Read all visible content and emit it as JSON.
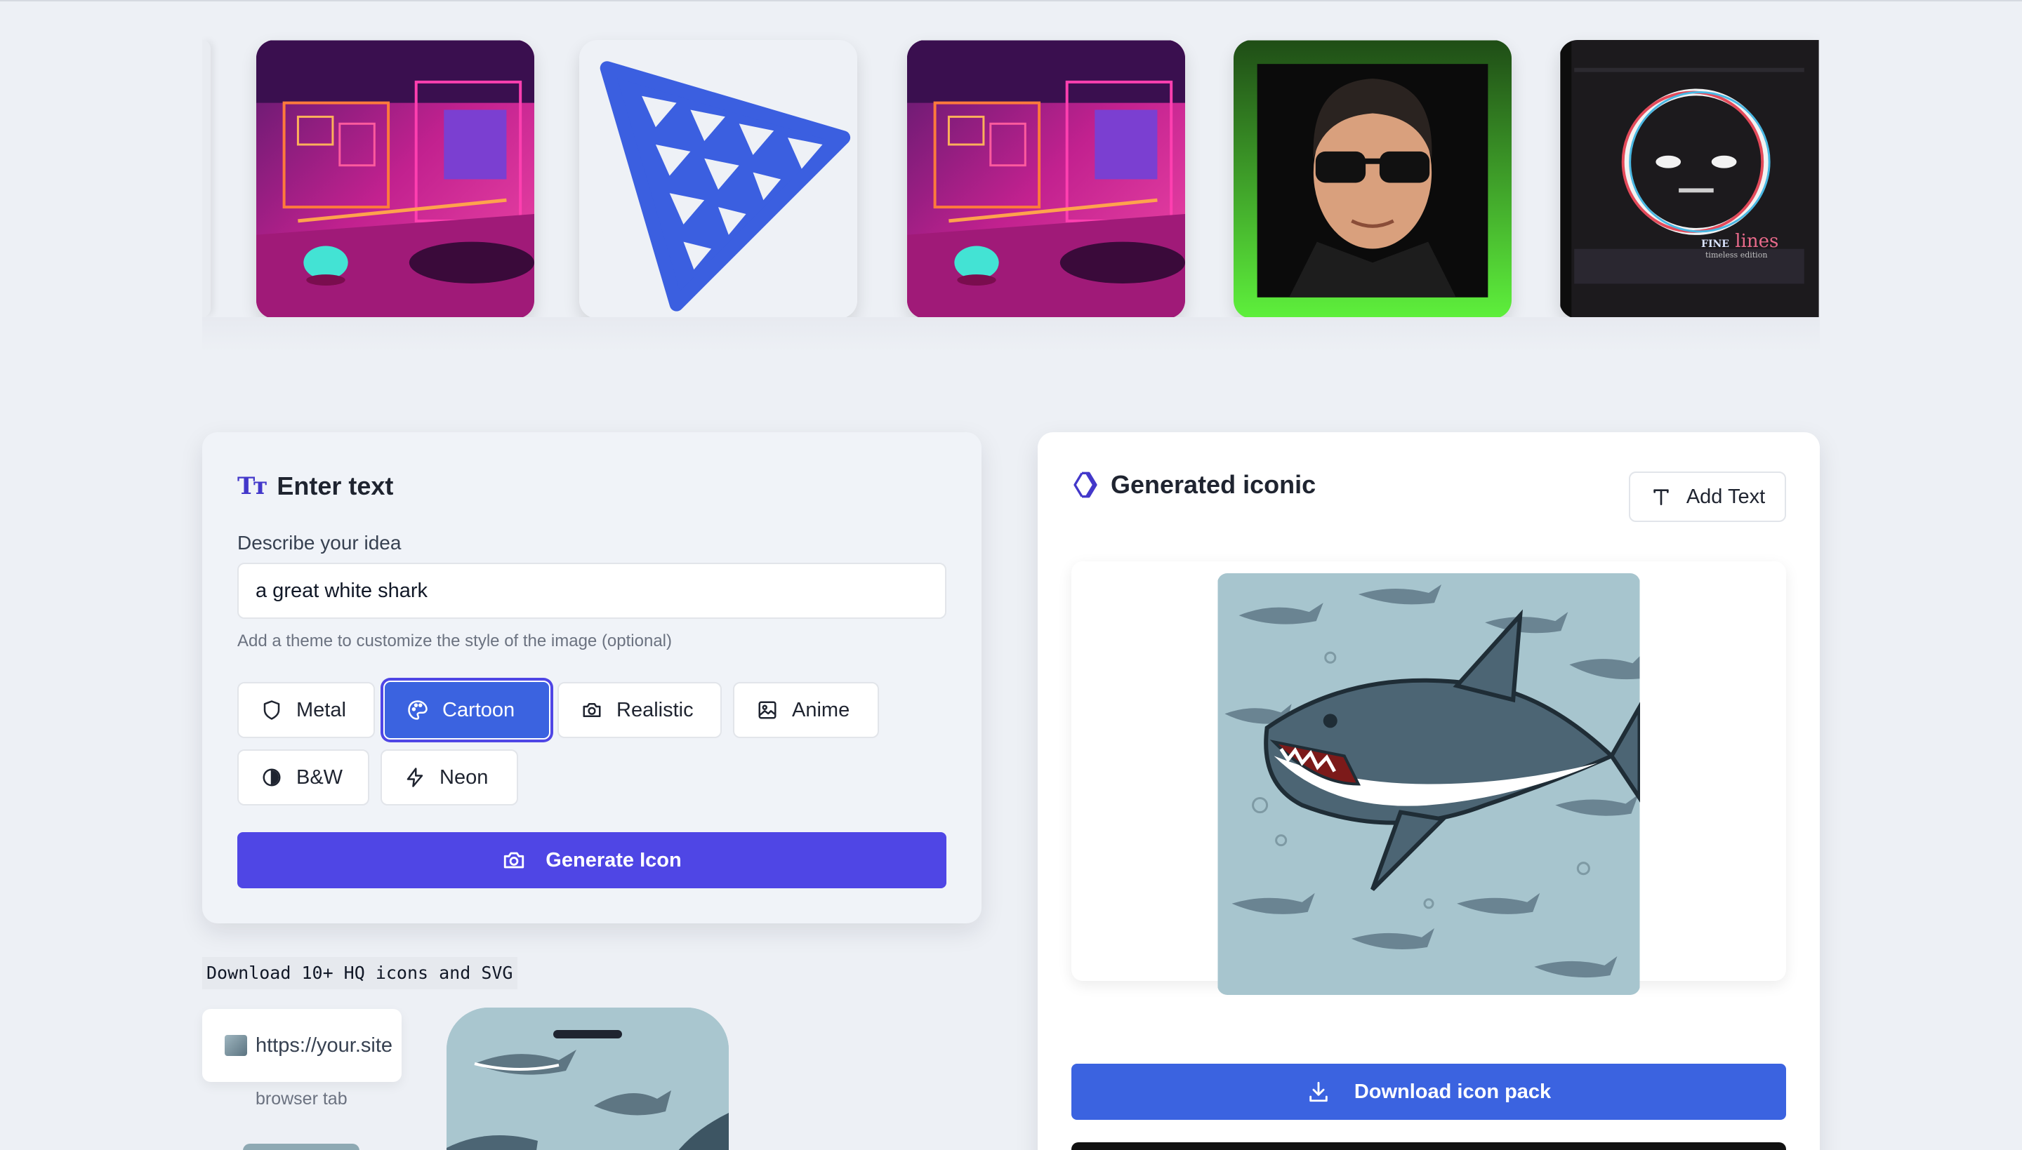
{
  "gallery": {
    "items": [
      {
        "icon": "neon-room-image"
      },
      {
        "icon": "blue-triangle-logo-image"
      },
      {
        "icon": "neon-room-image"
      },
      {
        "icon": "man-sunglasses-portrait-image"
      },
      {
        "icon": "glitch-face-album-image",
        "text_main": "lines",
        "text_prefix": "FINE",
        "text_sub": "timeless edition"
      }
    ]
  },
  "enter_text": {
    "title": "Enter text",
    "title_icon": "Tт",
    "idea_label": "Describe your idea",
    "idea_value": "a great white shark",
    "theme_hint": "Add a theme to customize the style of the image (optional)",
    "themes": [
      {
        "label": "Metal",
        "icon": "shield-icon"
      },
      {
        "label": "Cartoon",
        "icon": "palette-icon",
        "selected": true
      },
      {
        "label": "Realistic",
        "icon": "camera-icon"
      },
      {
        "label": "Anime",
        "icon": "image-icon"
      },
      {
        "label": "B&W",
        "icon": "contrast-icon"
      },
      {
        "label": "Neon",
        "icon": "lightning-icon"
      }
    ],
    "generate_label": "Generate Icon"
  },
  "download_section": {
    "caption": "Download 10+ HQ icons and SVG",
    "site_url": "https://your.site",
    "site_caption": "browser tab"
  },
  "generated": {
    "title": "Generated iconic",
    "add_text_label": "Add Text",
    "download_label": "Download icon pack",
    "preview_subject": "shark-cartoon-image"
  },
  "colors": {
    "primary": "#4f46e5",
    "blue": "#3b63e0",
    "background": "#edf0f5"
  }
}
